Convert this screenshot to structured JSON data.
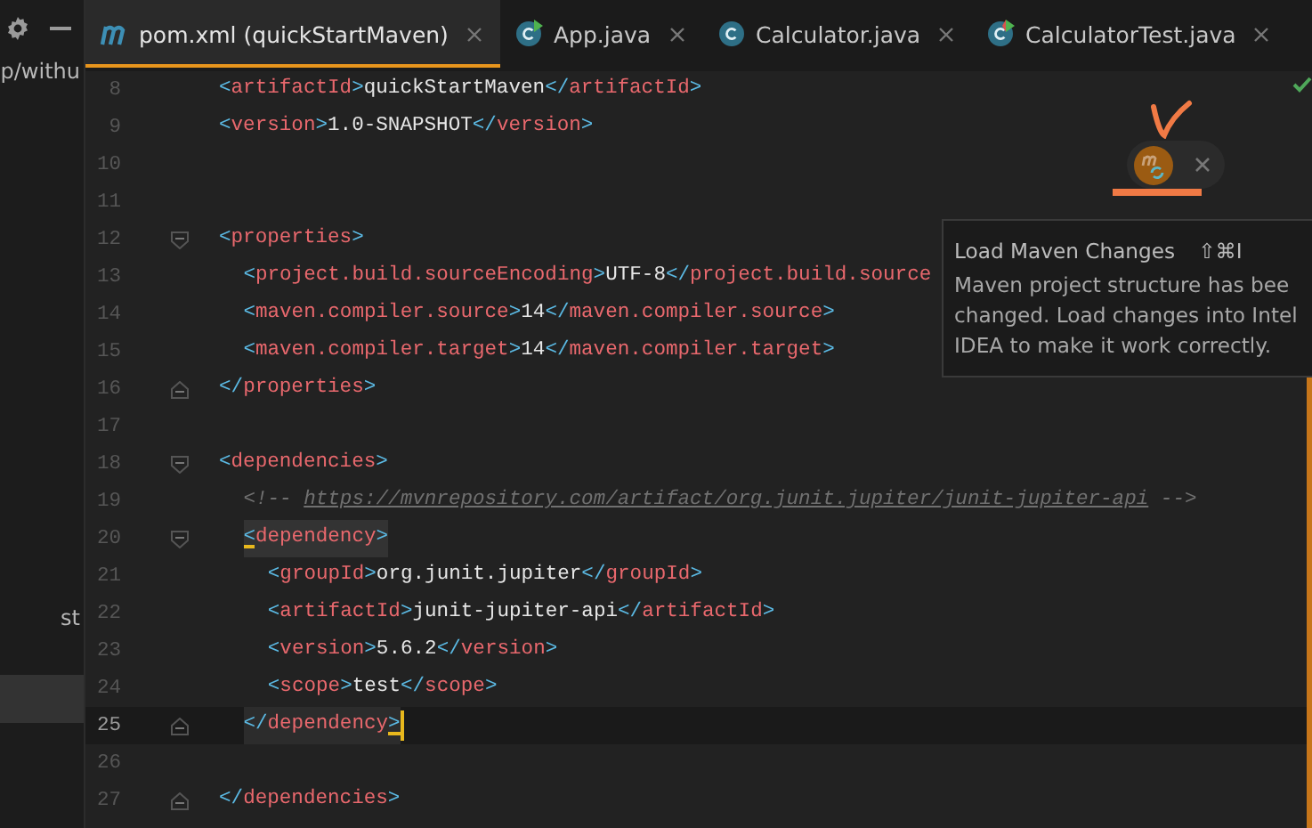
{
  "sidebar": {
    "items": [
      {
        "label": "p/withu",
        "selected": false
      },
      {
        "label": "st",
        "selected": false
      },
      {
        "selected": true
      }
    ]
  },
  "tabs": [
    {
      "label": "pom.xml (quickStartMaven)",
      "kind": "maven",
      "selected": true
    },
    {
      "label": "App.java",
      "kind": "runnable-class",
      "selected": false
    },
    {
      "label": "Calculator.java",
      "kind": "class",
      "selected": false
    },
    {
      "label": "CalculatorTest.java",
      "kind": "test-class",
      "selected": false
    }
  ],
  "editor": {
    "lines": [
      {
        "number": "8",
        "tokens": [
          {
            "kind": "bracket",
            "text": "<"
          },
          {
            "kind": "tag",
            "text": "artifactId"
          },
          {
            "kind": "bracket",
            "text": ">"
          },
          {
            "kind": "value",
            "text": "quickStartMaven"
          },
          {
            "kind": "bracket",
            "text": "</"
          },
          {
            "kind": "tag",
            "text": "artifactId"
          },
          {
            "kind": "bracket",
            "text": ">"
          }
        ]
      },
      {
        "number": "9",
        "tokens": [
          {
            "kind": "bracket",
            "text": "<"
          },
          {
            "kind": "tag",
            "text": "version"
          },
          {
            "kind": "bracket",
            "text": ">"
          },
          {
            "kind": "value",
            "text": "1.0-SNAPSHOT"
          },
          {
            "kind": "bracket",
            "text": "</"
          },
          {
            "kind": "tag",
            "text": "version"
          },
          {
            "kind": "bracket",
            "text": ">"
          }
        ]
      },
      {
        "number": "10"
      },
      {
        "number": "11"
      },
      {
        "number": "12",
        "tokens": [
          {
            "kind": "bracket",
            "text": "<"
          },
          {
            "kind": "tag",
            "text": "properties"
          },
          {
            "kind": "bracket",
            "text": ">"
          }
        ],
        "children": [
          {
            "number": "13",
            "tokens": [
              {
                "kind": "bracket",
                "text": "<"
              },
              {
                "kind": "tag",
                "text": "project.build.sourceEncoding"
              },
              {
                "kind": "bracket",
                "text": ">"
              },
              {
                "kind": "value",
                "text": "UTF-8"
              },
              {
                "kind": "bracket",
                "text": "</"
              },
              {
                "kind": "tag",
                "text": "project.build.source"
              }
            ]
          },
          {
            "number": "14",
            "tokens": [
              {
                "kind": "bracket",
                "text": "<"
              },
              {
                "kind": "tag",
                "text": "maven.compiler.source"
              },
              {
                "kind": "bracket",
                "text": ">"
              },
              {
                "kind": "value",
                "text": "14"
              },
              {
                "kind": "bracket",
                "text": "</"
              },
              {
                "kind": "tag",
                "text": "maven.compiler.source"
              },
              {
                "kind": "bracket",
                "text": ">"
              }
            ]
          },
          {
            "number": "15",
            "tokens": [
              {
                "kind": "bracket",
                "text": "<"
              },
              {
                "kind": "tag",
                "text": "maven.compiler.target"
              },
              {
                "kind": "bracket",
                "text": ">"
              },
              {
                "kind": "value",
                "text": "14"
              },
              {
                "kind": "bracket",
                "text": "</"
              },
              {
                "kind": "tag",
                "text": "maven.compiler.target"
              },
              {
                "kind": "bracket",
                "text": ">"
              }
            ]
          }
        ]
      },
      {
        "number": "16",
        "fold_end": true,
        "tokens": [
          {
            "kind": "bracket",
            "text": "</"
          },
          {
            "kind": "tag",
            "text": "properties"
          },
          {
            "kind": "bracket",
            "text": ">"
          }
        ]
      },
      {
        "number": "17"
      },
      {
        "number": "18",
        "tokens": [
          {
            "kind": "bracket",
            "text": "<"
          },
          {
            "kind": "tag",
            "text": "dependencies"
          },
          {
            "kind": "bracket",
            "text": ">"
          }
        ],
        "children": [
          {
            "number": "19",
            "tokens": [
              {
                "kind": "comment",
                "text": "<!-- "
              },
              {
                "kind": "url",
                "text": "https://mvnrepository.com/artifact/org.junit.jupiter/junit-jupiter-api"
              },
              {
                "kind": "comment",
                "text": " -->"
              }
            ]
          },
          {
            "number": "20",
            "highlight": true,
            "tokens": [
              {
                "kind": "matched",
                "text": "<"
              },
              {
                "kind": "tag",
                "text": "dependency"
              },
              {
                "kind": "bracket",
                "text": ">"
              }
            ],
            "children": [
              {
                "number": "21",
                "tokens": [
                  {
                    "kind": "bracket",
                    "text": "<"
                  },
                  {
                    "kind": "tag",
                    "text": "groupId"
                  },
                  {
                    "kind": "bracket",
                    "text": ">"
                  },
                  {
                    "kind": "value",
                    "text": "org.junit.jupiter"
                  },
                  {
                    "kind": "bracket",
                    "text": "</"
                  },
                  {
                    "kind": "tag",
                    "text": "groupId"
                  },
                  {
                    "kind": "bracket",
                    "text": ">"
                  }
                ]
              },
              {
                "number": "22",
                "tokens": [
                  {
                    "kind": "bracket",
                    "text": "<"
                  },
                  {
                    "kind": "tag",
                    "text": "artifactId"
                  },
                  {
                    "kind": "bracket",
                    "text": ">"
                  },
                  {
                    "kind": "value",
                    "text": "junit-jupiter-api"
                  },
                  {
                    "kind": "bracket",
                    "text": "</"
                  },
                  {
                    "kind": "tag",
                    "text": "artifactId"
                  },
                  {
                    "kind": "bracket",
                    "text": ">"
                  }
                ]
              },
              {
                "number": "23",
                "tokens": [
                  {
                    "kind": "bracket",
                    "text": "<"
                  },
                  {
                    "kind": "tag",
                    "text": "version"
                  },
                  {
                    "kind": "bracket",
                    "text": ">"
                  },
                  {
                    "kind": "value",
                    "text": "5.6.2"
                  },
                  {
                    "kind": "bracket",
                    "text": "</"
                  },
                  {
                    "kind": "tag",
                    "text": "version"
                  },
                  {
                    "kind": "bracket",
                    "text": ">"
                  }
                ]
              },
              {
                "number": "24",
                "tokens": [
                  {
                    "kind": "bracket",
                    "text": "<"
                  },
                  {
                    "kind": "tag",
                    "text": "scope"
                  },
                  {
                    "kind": "bracket",
                    "text": ">"
                  },
                  {
                    "kind": "value",
                    "text": "test"
                  },
                  {
                    "kind": "bracket",
                    "text": "</"
                  },
                  {
                    "kind": "tag",
                    "text": "scope"
                  },
                  {
                    "kind": "bracket",
                    "text": ">"
                  }
                ]
              }
            ]
          },
          {
            "number": "25",
            "fold_end": true,
            "highlight": true,
            "current": true,
            "caret": true,
            "tokens": [
              {
                "kind": "bracket",
                "text": "</"
              },
              {
                "kind": "tag",
                "text": "dependency"
              },
              {
                "kind": "matched",
                "text": ">"
              }
            ]
          }
        ]
      },
      {
        "number": "26"
      },
      {
        "number": "27",
        "fold_end": true,
        "tokens": [
          {
            "kind": "bracket",
            "text": "</"
          },
          {
            "kind": "tag",
            "text": "dependencies"
          },
          {
            "kind": "bracket",
            "text": ">"
          }
        ]
      }
    ]
  },
  "tooltip": {
    "title": "Load Maven Changes",
    "shortcut": "⇧⌘I",
    "lines": [
      "Maven project structure has bee",
      "changed. Load changes into Intel",
      "IDEA to make it work correctly."
    ]
  }
}
